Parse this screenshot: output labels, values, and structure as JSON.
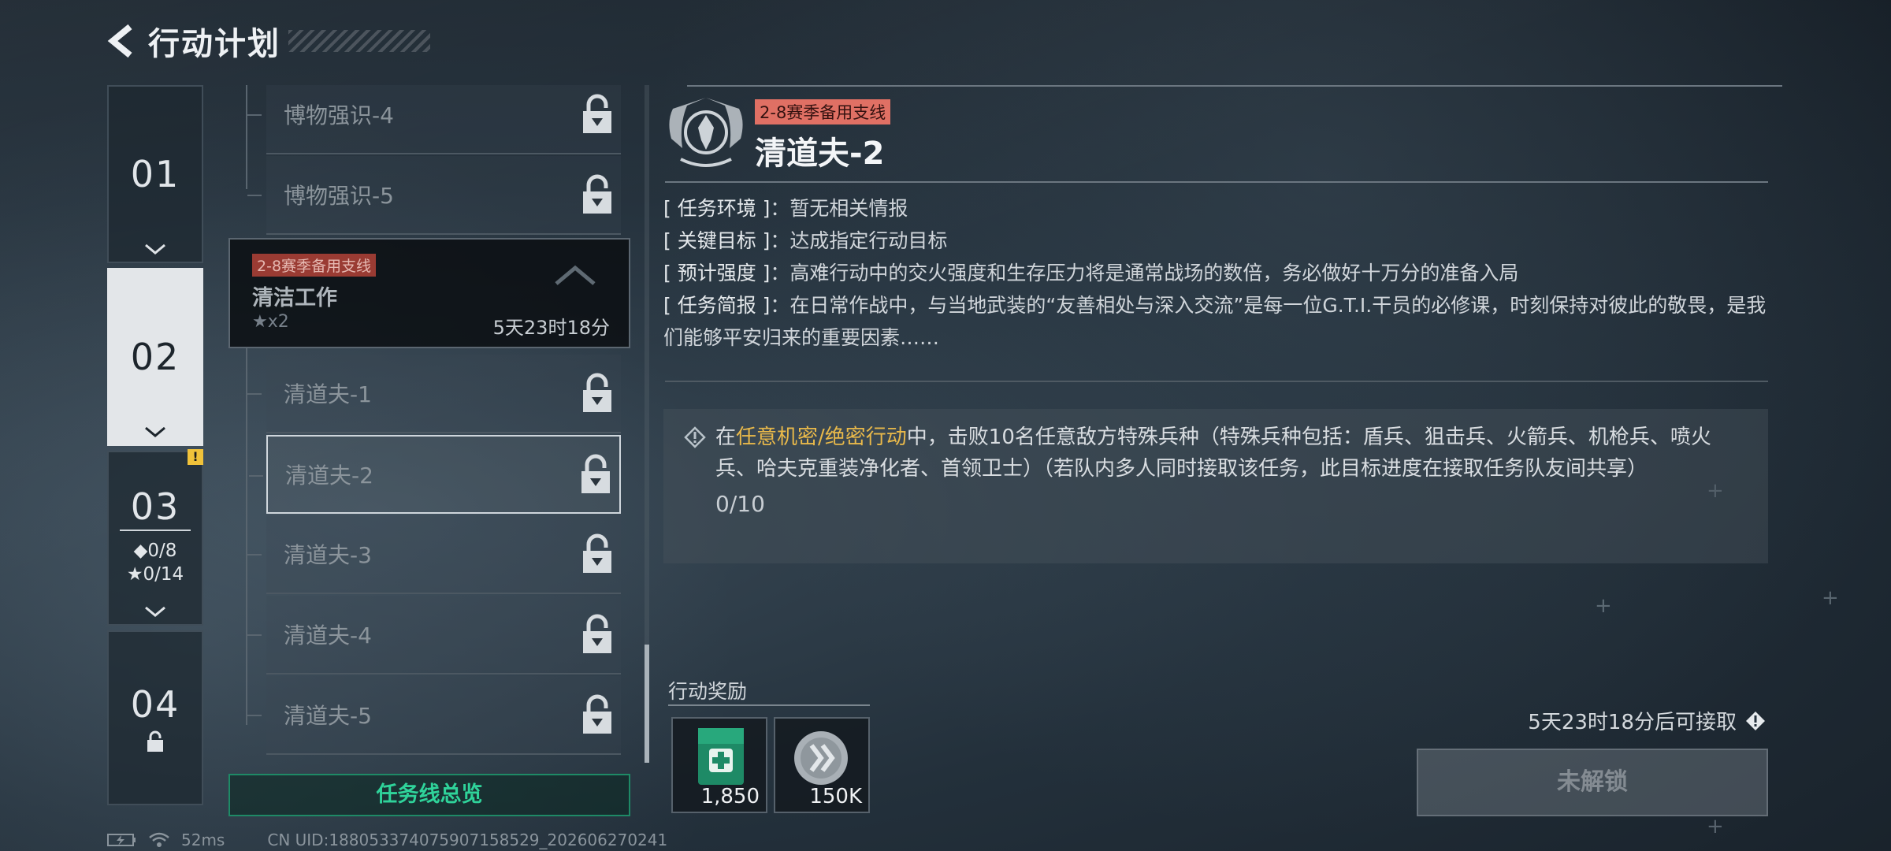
{
  "header": {
    "title": "行动计划"
  },
  "chapters": [
    {
      "num": "01"
    },
    {
      "num": "02"
    },
    {
      "num": "03",
      "diamond_stat": "◆0/8",
      "star_stat": "★0/14"
    },
    {
      "num": "04"
    }
  ],
  "tasklist": {
    "tasks_top": [
      "博物强识-4",
      "博物强识-5"
    ],
    "group": {
      "tag": "2-8赛季备用支线",
      "name": "清洁工作",
      "stars": "★x2",
      "time": "5天23时18分"
    },
    "tasks": [
      "清道夫-1",
      "清道夫-2",
      "清道夫-3",
      "清道夫-4",
      "清道夫-5"
    ],
    "overview_button": "任务线总览"
  },
  "detail": {
    "tag": "2-8赛季备用支线",
    "title": "清道夫-2",
    "info": [
      {
        "key": "[ 任务环境 ]",
        "value": "暂无相关情报"
      },
      {
        "key": "[ 关键目标 ]",
        "value": "达成指定行动目标"
      },
      {
        "key": "[ 预计强度 ]",
        "value": "高难行动中的交火强度和生存压力将是通常战场的数倍，务必做好十万分的准备入局"
      },
      {
        "key": "[ 任务简报 ]",
        "value": "在日常作战中，与当地武装的“友善相处与深入交流”是每一位G.T.I.干员的必修课，时刻保持对彼此的敬畏，是我们能够平安归来的重要因素……"
      }
    ],
    "objective": {
      "pre": "在",
      "highlight": "任意机密/绝密行动",
      "post": "中，击败10名任意敌方特殊兵种（特殊兵种包括：盾兵、狙击兵、火箭兵、机枪兵、喷火兵、哈夫克重装净化者、首领卫士）（若队内多人同时接取该任务，此目标进度在接取任务队友间共享）",
      "progress": "0/10"
    },
    "rewards_title": "行动奖励",
    "rewards": [
      {
        "icon": "medkit-card-icon",
        "amount": "1,850"
      },
      {
        "icon": "silver-coin-icon",
        "amount": "150K"
      }
    ],
    "available_text": "5天23时18分后可接取",
    "unlock_button": "未解锁"
  },
  "statusbar": {
    "ping": "52ms",
    "uid": "CN UID:18805337407590715852​9_202606270241"
  },
  "colors": {
    "accent_green": "#2fd39a",
    "tag_red": "#e07064",
    "highlight_gold": "#e9b94a",
    "warn_yellow": "#f0c23a"
  }
}
